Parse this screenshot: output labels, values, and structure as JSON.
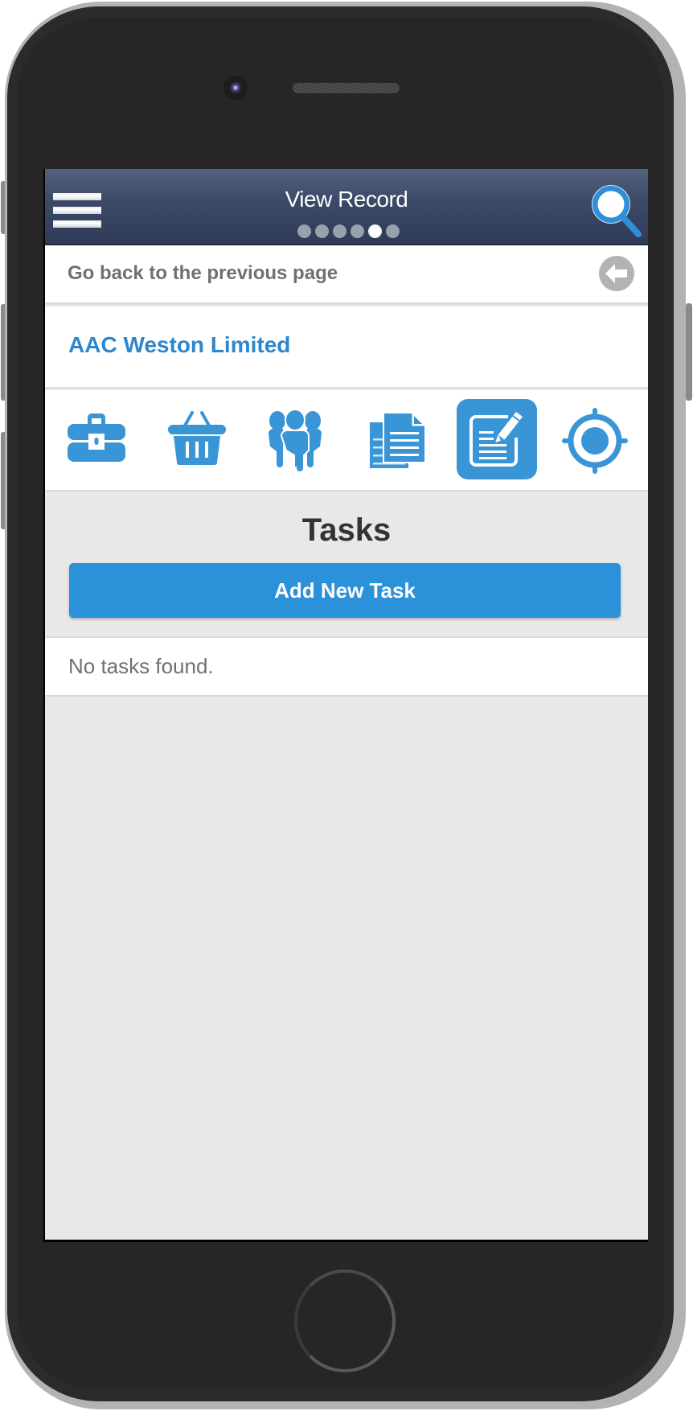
{
  "header": {
    "title": "View Record",
    "page_dots": {
      "count": 6,
      "active_index": 4
    },
    "menu_icon": "hamburger-menu-icon",
    "search_icon": "search-icon"
  },
  "back": {
    "label": "Go back to the previous page",
    "icon": "back-arrow-icon"
  },
  "record": {
    "title": "AAC Weston Limited"
  },
  "tabs": [
    {
      "icon": "briefcase-icon",
      "active": false
    },
    {
      "icon": "basket-icon",
      "active": false
    },
    {
      "icon": "people-icon",
      "active": false
    },
    {
      "icon": "documents-icon",
      "active": false
    },
    {
      "icon": "task-edit-icon",
      "active": true
    },
    {
      "icon": "target-location-icon",
      "active": false
    }
  ],
  "tasks": {
    "heading": "Tasks",
    "add_button_label": "Add New Task",
    "empty_message": "No tasks found."
  },
  "colors": {
    "accent": "#2b91d8",
    "header_top": "#55627f",
    "header_bottom": "#2f3b57",
    "link": "#2e86cc",
    "muted_text": "#707070"
  }
}
